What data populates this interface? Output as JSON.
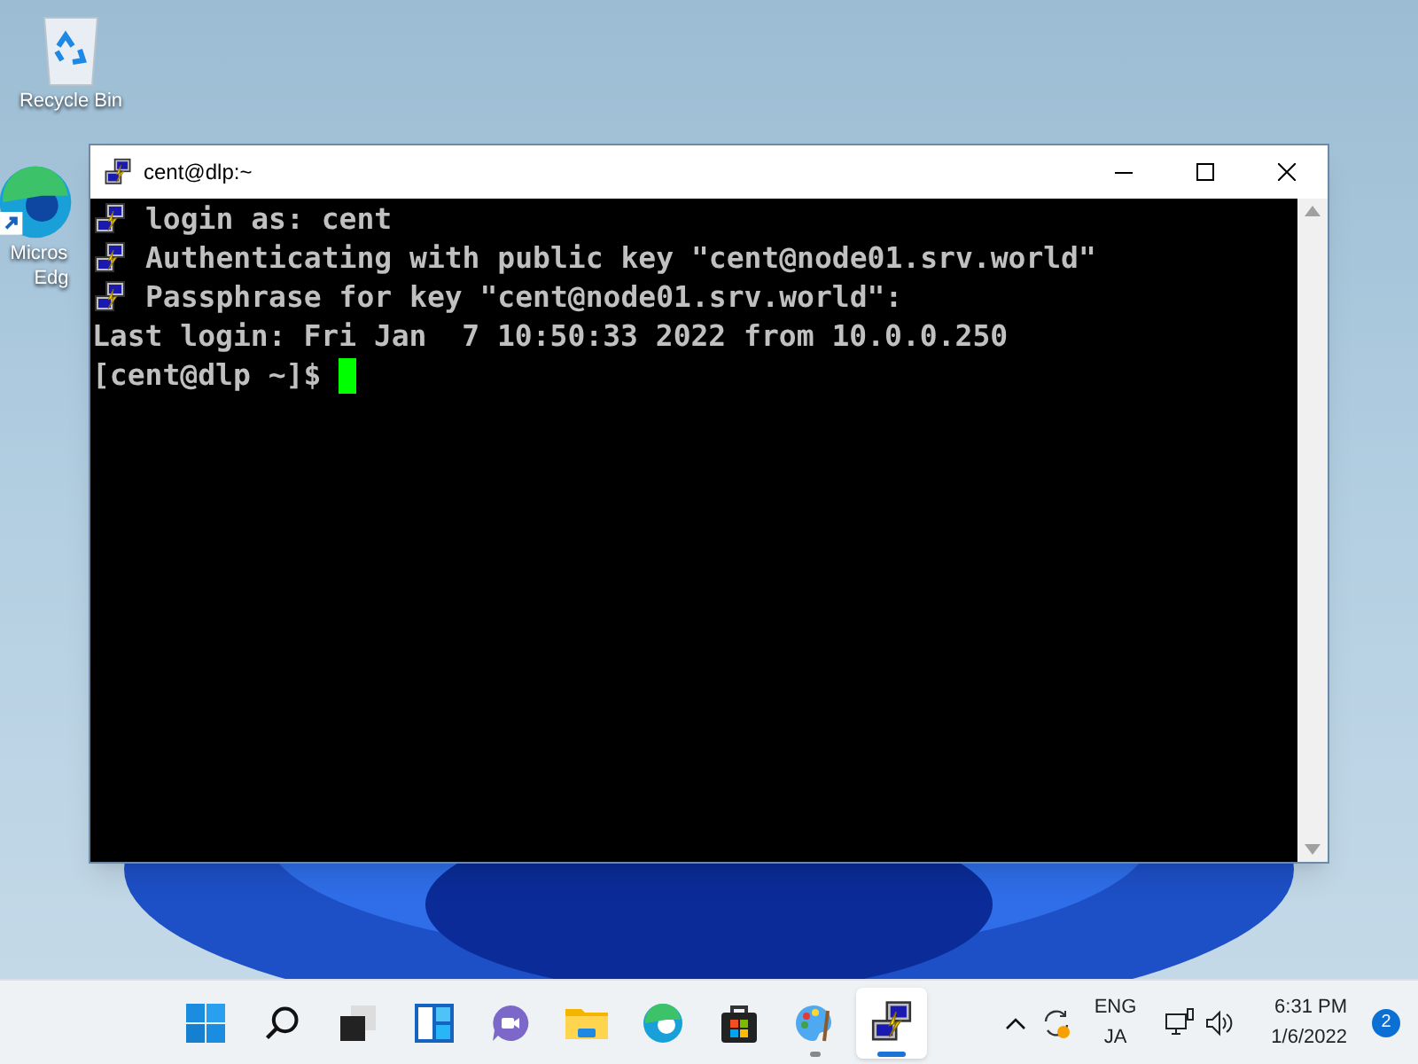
{
  "desktop_icons": [
    {
      "kind": "recycle",
      "lines": [
        "Recycle Bin"
      ]
    },
    {
      "kind": "edge",
      "lines": [
        "Micros",
        "Edg"
      ]
    }
  ],
  "window": {
    "title": "cent@dlp:~",
    "active": true
  },
  "terminal": {
    "lines": [
      {
        "kind": "putty",
        "text": "login as: cent"
      },
      {
        "kind": "putty",
        "text": "Authenticating with public key \"cent@node01.srv.world\""
      },
      {
        "kind": "putty",
        "text": "Passphrase for key \"cent@node01.srv.world\":"
      },
      {
        "kind": "plain",
        "text": "Last login: Fri Jan  7 10:50:33 2022 from 10.0.0.250"
      },
      {
        "kind": "prompt",
        "text": "[cent@dlp ~]$ "
      }
    ]
  },
  "taskbar": {
    "apps": [
      {
        "kind": "start",
        "running": false,
        "selected": false
      },
      {
        "kind": "search",
        "running": false,
        "selected": false
      },
      {
        "kind": "taskview",
        "running": false,
        "selected": false
      },
      {
        "kind": "widgets",
        "running": false,
        "selected": false
      },
      {
        "kind": "chat",
        "running": false,
        "selected": false
      },
      {
        "kind": "files",
        "running": false,
        "selected": false
      },
      {
        "kind": "edge",
        "running": false,
        "selected": false
      },
      {
        "kind": "store",
        "running": false,
        "selected": false
      },
      {
        "kind": "paint",
        "running": true,
        "selected": false
      },
      {
        "kind": "putty",
        "running": true,
        "selected": true
      }
    ],
    "language": [
      "ENG",
      "JA"
    ],
    "time": "6:31 PM",
    "date": "1/6/2022",
    "notifications": "2"
  }
}
